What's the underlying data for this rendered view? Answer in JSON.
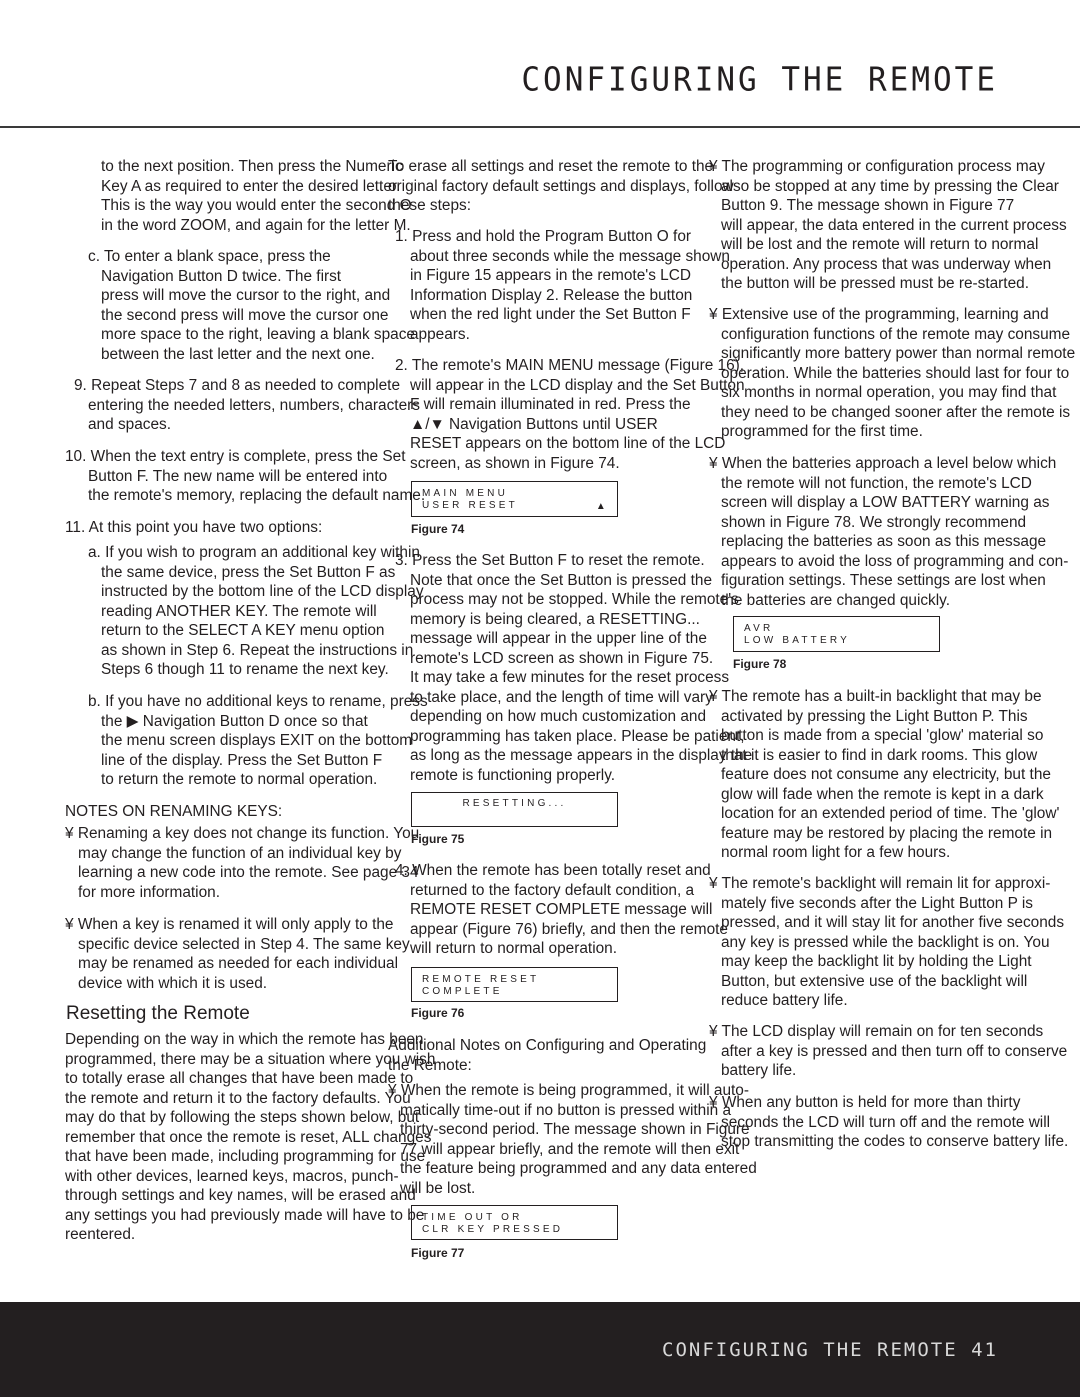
{
  "header": {
    "title": "CONFIGURING THE REMOTE"
  },
  "footer": {
    "text": "CONFIGURING THE REMOTE   41"
  },
  "blocks": [
    {
      "lines": [
        "to the next position. Then press the Numeric",
        "Key A as required to enter the desired letter.",
        "This is the way you would enter the second O",
        "in the word ZOOM, and again for the letter M."
      ]
    },
    {
      "lines": [
        "c. To enter a blank space, press the",
        "Navigation Button D twice. The first",
        "press will move the cursor to the right, and",
        "the second press will move the cursor one",
        "more space to the right, leaving a blank space",
        "between the last letter and the next one."
      ]
    },
    {
      "lines": [
        "9. Repeat Steps 7 and 8 as needed to complete",
        "entering the needed letters, numbers, characters",
        "and spaces."
      ]
    },
    {
      "lines": [
        "10. When the text entry is complete, press the Set",
        "Button F. The new name will be entered into",
        "the remote's memory, replacing the default name."
      ]
    },
    {
      "lines": [
        "11. At this point you have two options:"
      ]
    },
    {
      "lines": [
        "a. If you wish to program an additional key within",
        "the same device, press the Set Button F as",
        "instructed by the bottom line of the LCD display",
        "reading ANOTHER KEY. The remote will",
        "return to the SELECT A KEY menu option",
        "as shown in Step 6. Repeat the instructions in",
        "Steps 6 though 11 to rename the next key."
      ]
    },
    {
      "lines": [
        "b. If you have no additional keys to rename, press",
        "the ▶ Navigation Button D once so that",
        "the menu screen displays EXIT on the bottom",
        "line of the display. Press the Set Button F",
        "to return the remote to normal operation."
      ]
    },
    {
      "lines": [
        "NOTES ON RENAMING KEYS:"
      ]
    },
    {
      "lines": [
        "¥ Renaming a key does not change its function. You",
        "may change the function of an individual key by",
        "learning a new code into the remote. See page 34",
        "for more information."
      ]
    },
    {
      "lines": [
        "¥ When a key is renamed it will only apply to the",
        "specific device selected in Step 4. The same key",
        "may be renamed as needed for each individual",
        "device with which it is used."
      ]
    },
    {
      "lines": [
        "Depending on the way in which the remote has been",
        "programmed, there may be a situation where you wish",
        "to totally erase all changes that have been made to",
        "the remote and return it to the factory defaults. You",
        "may do that by following the steps shown below, but",
        "remember that once the remote is reset, ALL changes",
        "that have been made, including programming for use",
        "with other devices, learned keys, macros, punch-",
        "through settings and key names, will be erased and",
        "any settings you had previously made will have to be",
        "reentered."
      ]
    },
    {
      "lines": [
        "To erase all settings and reset the remote to the",
        "original factory default settings and displays, follow",
        "these steps:"
      ]
    },
    {
      "lines": [
        "1. Press and hold the Program Button O for",
        "about three seconds while the message shown",
        "in Figure 15 appears in the remote's LCD",
        "Information Display 2. Release the button",
        "when the red light under the Set Button F",
        "appears."
      ]
    },
    {
      "lines": [
        "2. The remote's MAIN MENU message (Figure 16),",
        "will appear in the LCD display and the Set Button",
        "F will remain illuminated in red. Press the",
        "▲/▼ Navigation Buttons until USER",
        "RESET appears on the bottom line of the LCD",
        "screen, as shown in Figure 74."
      ]
    },
    {
      "lines": [
        "3. Press the Set Button F to reset the remote.",
        "Note that once the Set Button is pressed the",
        "process may not be stopped. While the remote's",
        "memory is being cleared, a RESETTING...",
        "message will appear in the upper line of the",
        "remote's LCD screen as shown in Figure 75.",
        "It may take a few minutes for the reset process",
        "to take place, and the length of time will vary",
        "depending on how much customization and",
        "programming has taken place. Please be patient,",
        "as long as the message appears in the display the",
        "remote is functioning properly."
      ]
    },
    {
      "lines": [
        "4. When the remote has been totally reset and",
        "returned to the factory default condition, a",
        "REMOTE RESET COMPLETE message will",
        "appear (Figure 76) briefly, and then the remote",
        "will return to normal operation."
      ]
    },
    {
      "lines": [
        "Additional Notes on Configuring and Operating",
        "the Remote:"
      ]
    },
    {
      "lines": [
        "¥ When the remote is being programmed, it will auto-",
        "matically time-out if no button is pressed within a",
        "thirty-second period. The message shown in Figure",
        "77 will appear briefly, and the remote will then exit",
        "the feature being programmed and any data entered",
        "will be lost."
      ]
    },
    {
      "lines": [
        "¥ The programming or configuration process may",
        "also be stopped at any time by pressing the Clear",
        "Button 9. The message shown in Figure 77",
        "will appear, the data entered in the current process",
        "will be lost and the remote will return to normal",
        "operation. Any process that was underway when",
        "the button will be pressed must be re-started."
      ]
    },
    {
      "lines": [
        "¥ Extensive use of the programming, learning and",
        "configuration functions of the remote may consume",
        "significantly more battery power than normal remote",
        "operation. While the batteries should last for four to",
        "six months in normal operation, you may find that",
        "they need to be changed sooner after the remote is",
        "programmed for the first time."
      ]
    },
    {
      "lines": [
        "¥ When the batteries approach a level below which",
        "the remote will not function, the remote's LCD",
        "screen will display a LOW BATTERY warning as",
        "shown in Figure 78. We strongly recommend",
        "replacing the batteries as soon as this message",
        "appears to avoid the loss of programming and con-",
        "figuration settings. These settings are lost when",
        "the batteries are changed quickly."
      ]
    },
    {
      "lines": [
        "¥ The remote has a built-in backlight that may be",
        "activated by pressing the Light Button P. This",
        "button is made from a special 'glow' material so",
        "that it is easier to find in dark rooms. This glow",
        "feature does not consume any electricity, but the",
        "glow will fade when the remote is kept in a dark",
        "location for an extended period of time. The 'glow'",
        "feature may be restored by placing the remote in",
        "normal room light for a few hours."
      ]
    },
    {
      "lines": [
        "¥ The remote's backlight will remain lit for approxi-",
        "mately five seconds after the Light Button P is",
        "pressed, and it will stay lit for another five seconds",
        "any key is pressed while the backlight is on. You",
        "may keep the backlight lit by holding the Light",
        "Button, but extensive use of the backlight will",
        "reduce battery life."
      ]
    },
    {
      "lines": [
        "¥ The LCD display will remain on for ten seconds",
        "after a key is pressed and then turn off to conserve",
        "battery life."
      ]
    },
    {
      "lines": [
        "¥ When any button is held for more than thirty",
        "seconds the LCD will turn off and the remote will",
        "stop transmitting the codes to conserve battery life."
      ]
    }
  ],
  "section_heading": "Resetting the Remote",
  "figures": [
    {
      "caption": "Figure 74",
      "lcd": [
        "MAIN MENU",
        "USER RESET"
      ],
      "arrow": "▲"
    },
    {
      "caption": "Figure 75",
      "lcd": [
        "RESETTING..."
      ]
    },
    {
      "caption": "Figure 76",
      "lcd": [
        "REMOTE RESET",
        "COMPLETE"
      ]
    },
    {
      "caption": "Figure 77",
      "lcd": [
        "TIME OUT OR",
        "CLR KEY PRESSED"
      ]
    },
    {
      "caption": "Figure 78",
      "lcd": [
        "AVR",
        "LOW BATTERY"
      ]
    }
  ]
}
